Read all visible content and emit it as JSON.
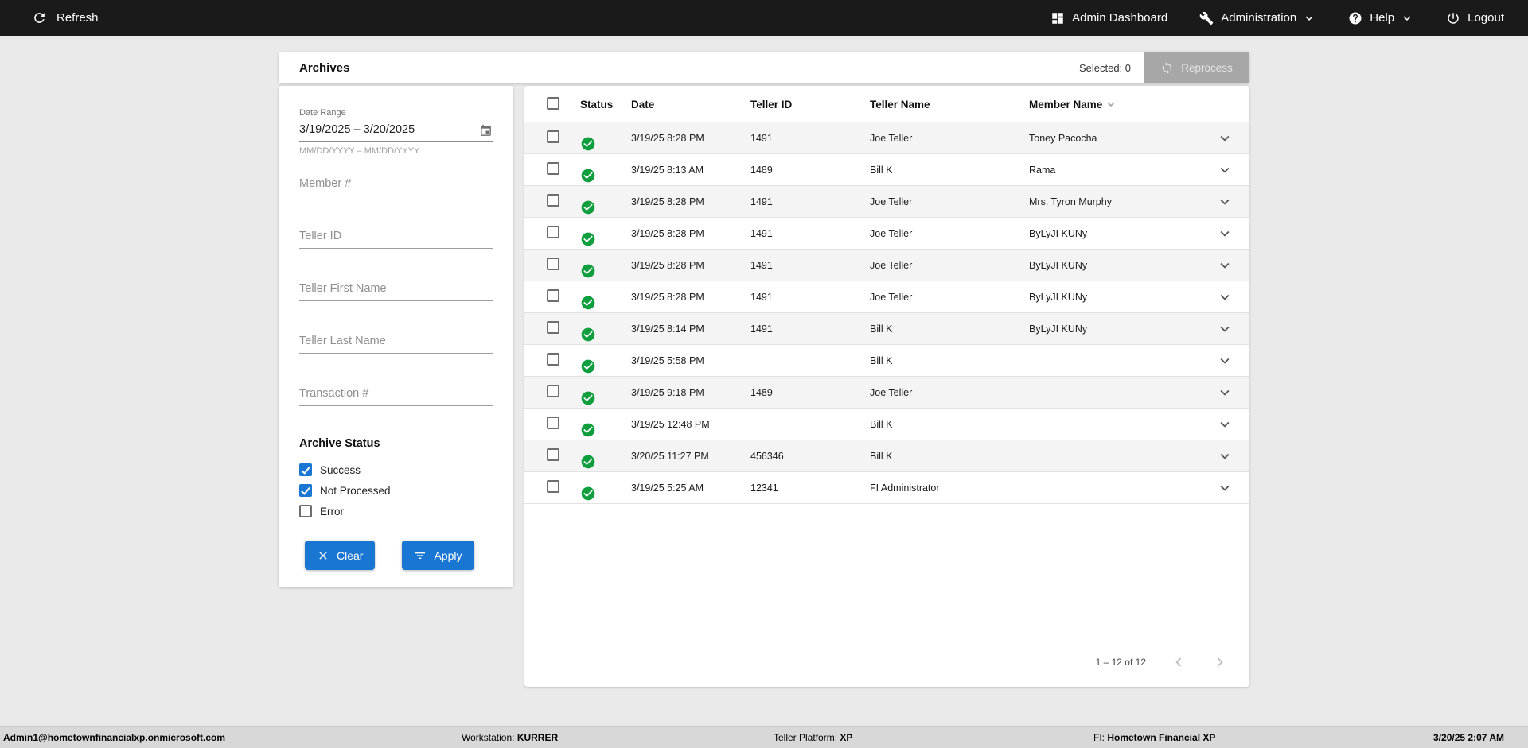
{
  "topbar": {
    "refresh": "Refresh",
    "admin_dashboard": "Admin Dashboard",
    "administration": "Administration",
    "help": "Help",
    "logout": "Logout"
  },
  "header": {
    "title": "Archives",
    "selected_label": "Selected: 0",
    "reprocess_label": "Reprocess"
  },
  "filters": {
    "date_range_label": "Date Range",
    "date_range_value": "3/19/2025 – 3/20/2025",
    "date_range_hint": "MM/DD/YYYY – MM/DD/YYYY",
    "member_placeholder": "Member #",
    "teller_id_placeholder": "Teller ID",
    "teller_first_placeholder": "Teller First Name",
    "teller_last_placeholder": "Teller Last Name",
    "transaction_placeholder": "Transaction #",
    "archive_status_label": "Archive Status",
    "statuses": [
      {
        "label": "Success",
        "checked": true
      },
      {
        "label": "Not Processed",
        "checked": true
      },
      {
        "label": "Error",
        "checked": false
      }
    ],
    "clear_label": "Clear",
    "apply_label": "Apply"
  },
  "table": {
    "columns": [
      "Status",
      "Date",
      "Teller ID",
      "Teller Name",
      "Member Name"
    ],
    "rows": [
      {
        "status": "success",
        "date": "3/19/25 8:28 PM",
        "teller_id": "1491",
        "teller_name": "Joe Teller",
        "member_name": "Toney Pacocha"
      },
      {
        "status": "success",
        "date": "3/19/25 8:13 AM",
        "teller_id": "1489",
        "teller_name": "Bill K",
        "member_name": "Rama"
      },
      {
        "status": "success",
        "date": "3/19/25 8:28 PM",
        "teller_id": "1491",
        "teller_name": "Joe Teller",
        "member_name": "Mrs. Tyron Murphy"
      },
      {
        "status": "success",
        "date": "3/19/25 8:28 PM",
        "teller_id": "1491",
        "teller_name": "Joe Teller",
        "member_name": "ByLyJI KUNy"
      },
      {
        "status": "success",
        "date": "3/19/25 8:28 PM",
        "teller_id": "1491",
        "teller_name": "Joe Teller",
        "member_name": "ByLyJI KUNy"
      },
      {
        "status": "success",
        "date": "3/19/25 8:28 PM",
        "teller_id": "1491",
        "teller_name": "Joe Teller",
        "member_name": "ByLyJI KUNy"
      },
      {
        "status": "success",
        "date": "3/19/25 8:14 PM",
        "teller_id": "1491",
        "teller_name": "Bill K",
        "member_name": "ByLyJI KUNy"
      },
      {
        "status": "success",
        "date": "3/19/25 5:58 PM",
        "teller_id": "",
        "teller_name": "Bill K",
        "member_name": ""
      },
      {
        "status": "success",
        "date": "3/19/25 9:18 PM",
        "teller_id": "1489",
        "teller_name": "Joe Teller",
        "member_name": ""
      },
      {
        "status": "success",
        "date": "3/19/25 12:48 PM",
        "teller_id": "",
        "teller_name": "Bill K",
        "member_name": ""
      },
      {
        "status": "success",
        "date": "3/20/25 11:27 PM",
        "teller_id": "456346",
        "teller_name": "Bill K",
        "member_name": ""
      },
      {
        "status": "success",
        "date": "3/19/25 5:25 AM",
        "teller_id": "12341",
        "teller_name": "FI Administrator",
        "member_name": ""
      }
    ],
    "pagination": "1 – 12 of 12"
  },
  "footer": {
    "user": "Admin1@hometownfinancialxp.onmicrosoft.com",
    "workstation_label": "Workstation:",
    "workstation_value": "KURRER",
    "platform_label": "Teller Platform:",
    "platform_value": "XP",
    "fi_label": "FI:",
    "fi_value": "Hometown Financial XP",
    "datetime": "3/20/25 2:07 AM"
  },
  "icons": {
    "refresh-icon": "circular arrow",
    "dashboard-icon": "grid of tiles",
    "wrench-icon": "wrench",
    "help-icon": "question mark in circle",
    "power-icon": "power symbol",
    "chevron-down-icon": "caret down",
    "calendar-icon": "calendar",
    "sync-icon": "circular sync arrows",
    "close-icon": "x mark",
    "filter-icon": "filter lines",
    "check-circle-icon": "green circle with check",
    "chevron-left-icon": "caret left",
    "chevron-right-icon": "caret right"
  },
  "colors": {
    "topbar_bg": "#1a1a1a",
    "accent_blue": "#1976d2",
    "status_green": "#0e9e3e",
    "page_bg": "#eaeaea",
    "footer_bg": "#d8d8d8",
    "disabled_gray": "#a7a7a7"
  }
}
